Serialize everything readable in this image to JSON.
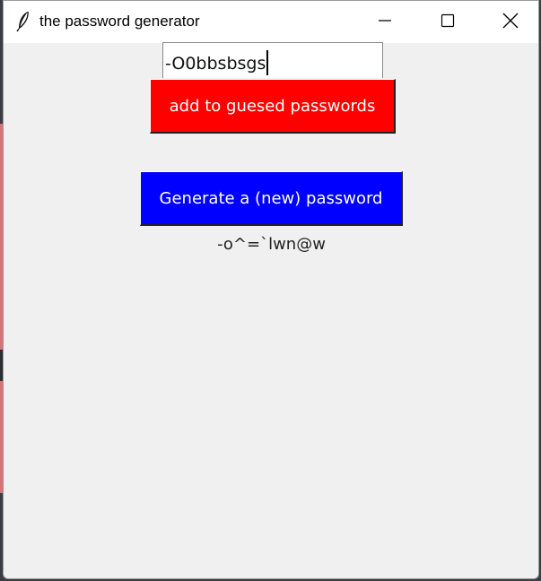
{
  "window": {
    "title": "the password generator",
    "icon": "feather-icon",
    "controls": [
      "minimize-icon",
      "maximize-icon",
      "close-icon"
    ]
  },
  "form": {
    "input_value": "-O0bbsbsgs",
    "add_button_label": "add to guesed passwords",
    "generate_button_label": "Generate a (new) password",
    "generated_password": "-o^=`lwn@w"
  },
  "colors": {
    "add_button_bg": "#ff0000",
    "generate_button_bg": "#0000ff",
    "button_text": "#ffffff",
    "window_bg": "#f0f0f0"
  }
}
